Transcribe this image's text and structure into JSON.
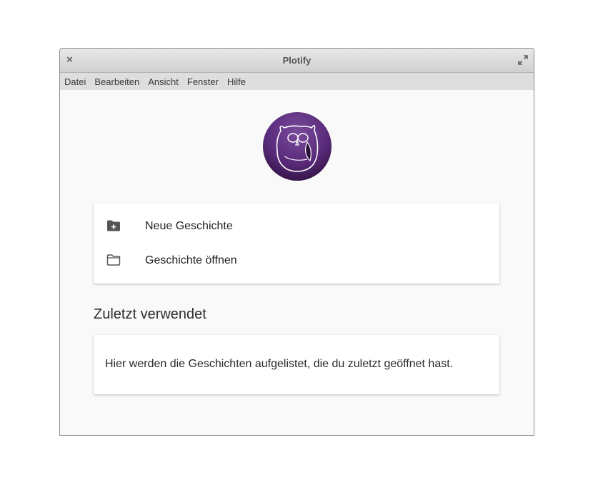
{
  "window": {
    "title": "Plotify",
    "close_glyph": "×"
  },
  "menubar": {
    "items": [
      {
        "label": "Datei"
      },
      {
        "label": "Bearbeiten"
      },
      {
        "label": "Ansicht"
      },
      {
        "label": "Fenster"
      },
      {
        "label": "Hilfe"
      }
    ]
  },
  "logo": {
    "icon": "owl-logo-icon",
    "color": "#5a2a7a"
  },
  "actions": {
    "new_story": {
      "label": "Neue Geschichte",
      "icon": "folder-plus-icon"
    },
    "open_story": {
      "label": "Geschichte öffnen",
      "icon": "folder-icon"
    }
  },
  "recent": {
    "heading": "Zuletzt verwendet",
    "empty_text": "Hier werden die Geschichten aufgelistet, die du zuletzt geöffnet hast."
  }
}
